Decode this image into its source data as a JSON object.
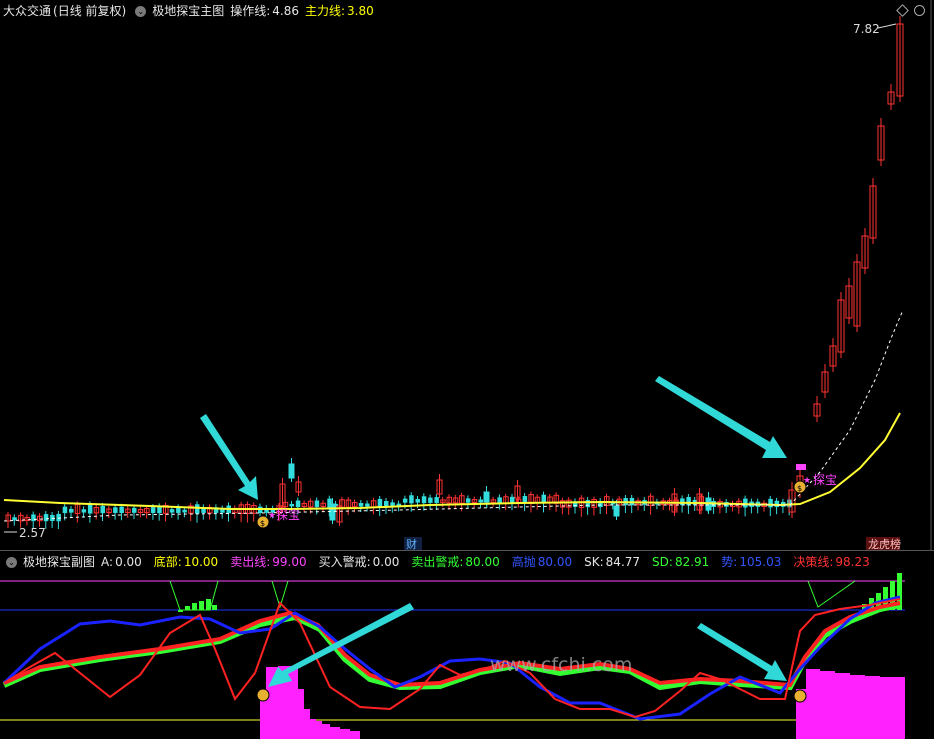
{
  "main_header": {
    "instrument": "大众交通",
    "period": "(日线 前复权)",
    "indicator_name": "极地探宝主图",
    "op_label": "操作线:",
    "op_value": "4.86",
    "main_label": "主力线:",
    "main_value": "3.80"
  },
  "main_chart": {
    "price_high": "7.82",
    "price_low": "2.57",
    "badge_cai": "财",
    "badge_longhu": "龙虎榜",
    "signal_label": "探宝"
  },
  "sub_header": {
    "indicator_name": "极地探宝副图",
    "items": [
      {
        "label": "A:",
        "value": "0.00",
        "color": "#e6e6e6"
      },
      {
        "label": "底部:",
        "value": "10.00",
        "color": "#ffff00"
      },
      {
        "label": "卖出线:",
        "value": "99.00",
        "color": "#ff44ff"
      },
      {
        "label": "买入警戒:",
        "value": "0.00",
        "color": "#e6e6e6"
      },
      {
        "label": "卖出警戒:",
        "value": "80.00",
        "color": "#33ff33"
      },
      {
        "label": "高抛",
        "value": "80.00",
        "color": "#3355ff"
      },
      {
        "label": "SK:",
        "value": "84.77",
        "color": "#e6e6e6"
      },
      {
        "label": "SD:",
        "value": "82.91",
        "color": "#33ff33"
      },
      {
        "label": "势:",
        "value": "105.03",
        "color": "#3355ff"
      },
      {
        "label": "决策线:",
        "value": "98.23",
        "color": "#ff3333"
      }
    ]
  },
  "watermark": "www.cfchi.com",
  "colors": {
    "background": "#000000",
    "up_candle": "#ff3333",
    "down_candle": "#33dddd",
    "main_line": "#ffff33",
    "magenta": "#ff22ff",
    "arrow": "#30d8d8",
    "blue": "#1a22ff",
    "red": "#ff2222",
    "green": "#33ff33"
  }
}
